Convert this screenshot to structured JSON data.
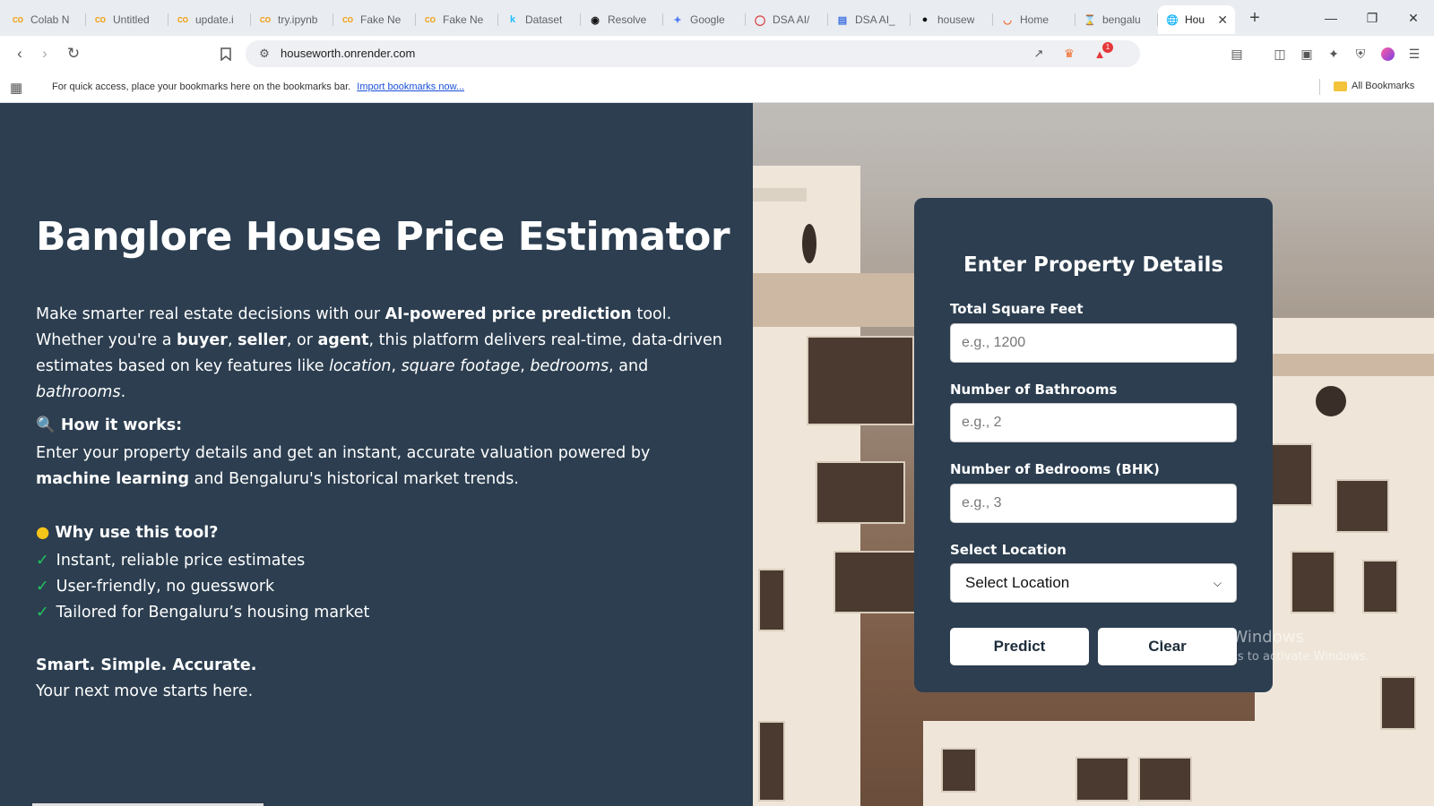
{
  "browser": {
    "tabs": [
      {
        "label": "Colab N",
        "icon": "colab-icon"
      },
      {
        "label": "Untitled",
        "icon": "colab-icon"
      },
      {
        "label": "update.i",
        "icon": "colab-icon"
      },
      {
        "label": "try.ipynb",
        "icon": "colab-icon"
      },
      {
        "label": "Fake Ne",
        "icon": "colab-icon"
      },
      {
        "label": "Fake Ne",
        "icon": "colab-icon"
      },
      {
        "label": "Dataset",
        "icon": "kaggle-icon"
      },
      {
        "label": "Resolve",
        "icon": "openai-icon"
      },
      {
        "label": "Google",
        "icon": "gemini-icon"
      },
      {
        "label": "DSA AI/",
        "icon": "dsa-icon"
      },
      {
        "label": "DSA AI_",
        "icon": "docs-icon"
      },
      {
        "label": "housew",
        "icon": "github-icon"
      },
      {
        "label": "Home",
        "icon": "render-icon"
      },
      {
        "label": "bengalu",
        "icon": "hourglass-icon"
      },
      {
        "label": "Hou",
        "icon": "globe-icon",
        "active": true
      }
    ],
    "url": "houseworth.onrender.com",
    "bookmarks_prompt": "For quick access, place your bookmarks here on the bookmarks bar.",
    "bookmarks_link": "Import bookmarks now...",
    "all_bookmarks": "All Bookmarks",
    "notification_count": "1"
  },
  "hero": {
    "title": "Banglore House Price Estimator",
    "intro_1": "Make smarter real estate decisions with our ",
    "intro_bold_1": "AI-powered price prediction",
    "intro_2": " tool. Whether you're a ",
    "intro_bold_2": "buyer",
    "intro_3": ", ",
    "intro_bold_3": "seller",
    "intro_4": ", or ",
    "intro_bold_4": "agent",
    "intro_5": ", this platform delivers real-time, data-driven estimates based on key features like ",
    "intro_it_1": "location",
    "intro_6": ", ",
    "intro_it_2": "square footage",
    "intro_7": ", ",
    "intro_it_3": "bedrooms",
    "intro_8": ", and ",
    "intro_it_4": "bathrooms",
    "intro_9": ".",
    "how_heading": "How it works:",
    "how_1": "Enter your property details and get an instant, accurate valuation powered by ",
    "how_bold": "machine learning",
    "how_2": " and Bengaluru's historical market trends.",
    "why_heading": "Why use this tool?",
    "benefits": [
      "Instant, reliable price estimates",
      "User-friendly, no guesswork",
      "Tailored for Bengaluru’s housing market"
    ],
    "tagline": "Smart. Simple. Accurate.",
    "tagline_sub": "Your next move starts here."
  },
  "form": {
    "title": "Enter Property Details",
    "sqft_label": "Total Square Feet",
    "sqft_placeholder": "e.g., 1200",
    "bath_label": "Number of Bathrooms",
    "bath_placeholder": "e.g., 2",
    "bhk_label": "Number of Bedrooms (BHK)",
    "bhk_placeholder": "e.g., 3",
    "location_label": "Select Location",
    "location_selected": "Select Location",
    "predict_label": "Predict",
    "clear_label": "Clear"
  },
  "overlay": {
    "activate_title": "Activate Windows",
    "activate_sub": "Go to Settings to activate Windows."
  },
  "colors": {
    "panel": "#2c3e50",
    "check": "#22c55e",
    "link": "#1a4fd8"
  }
}
